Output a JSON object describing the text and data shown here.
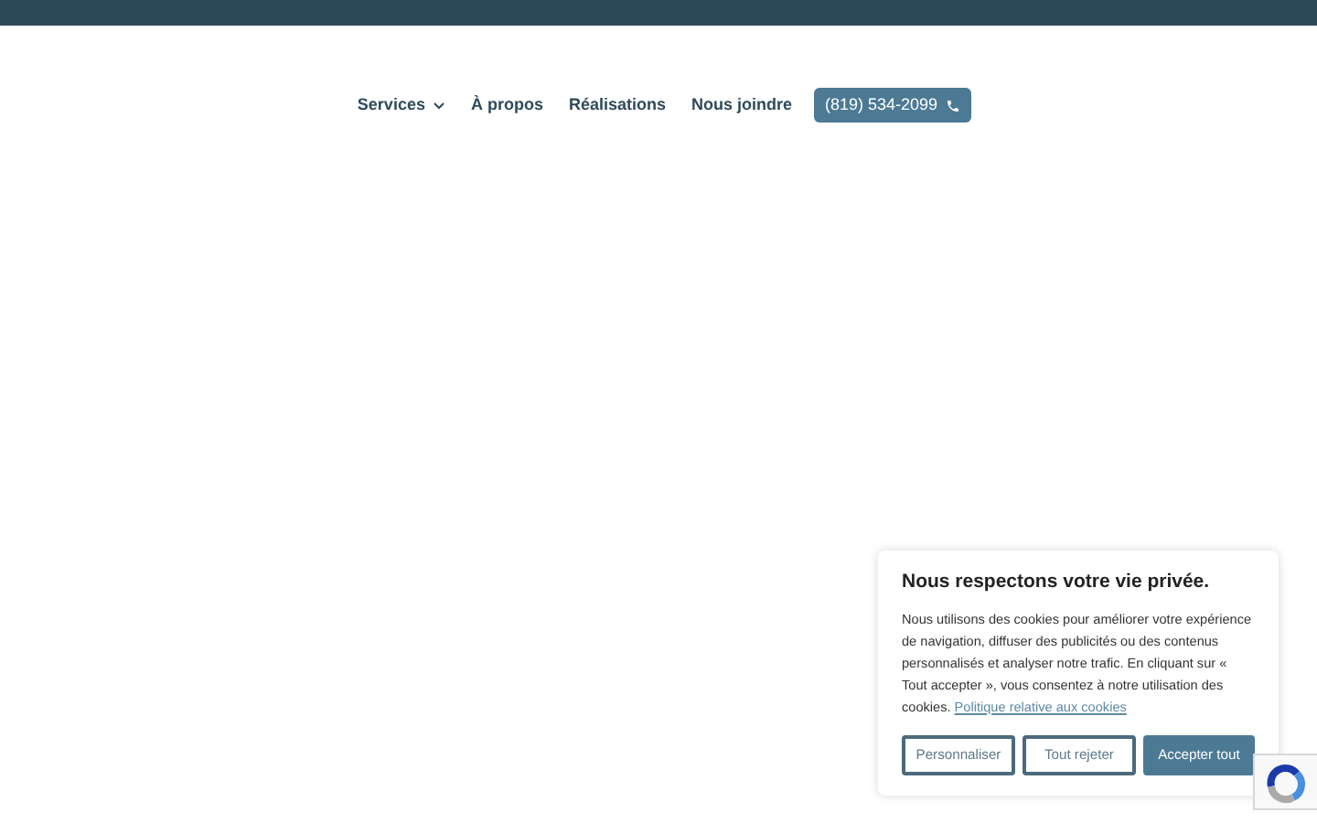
{
  "nav": {
    "items": [
      {
        "label": "Services",
        "has_dropdown": true
      },
      {
        "label": "À propos",
        "has_dropdown": false
      },
      {
        "label": "Réalisations",
        "has_dropdown": false
      },
      {
        "label": "Nous joindre",
        "has_dropdown": false
      }
    ],
    "phone_button": "(819) 534-2099"
  },
  "cookie_banner": {
    "title": "Nous respectons votre vie privée.",
    "text": "Nous utilisons des cookies pour améliorer votre expérience de navigation, diffuser des publicités ou des contenus personnalisés et analyser notre trafic. En cliquant sur « Tout accepter », vous consentez à notre utilisation des cookies.",
    "link": "Politique relative aux cookies",
    "buttons": [
      {
        "label": "Personnaliser",
        "kind": "outline"
      },
      {
        "label": "Tout rejeter",
        "kind": "outline"
      },
      {
        "label": "Accepter tout",
        "kind": "primary"
      }
    ]
  }
}
